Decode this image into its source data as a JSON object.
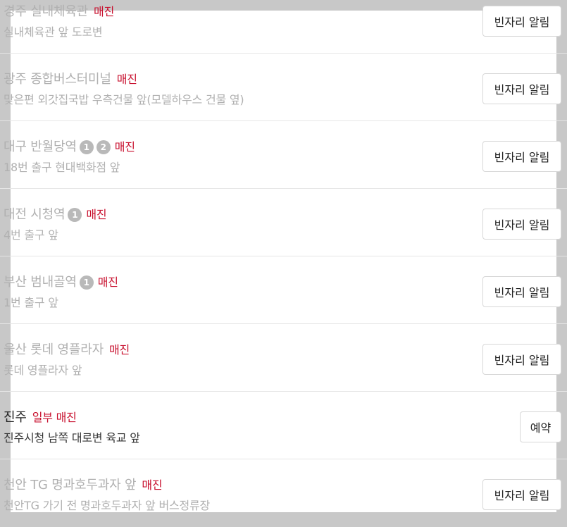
{
  "rows": [
    {
      "name": "경주 실내체육관",
      "badges": [],
      "status": "매진",
      "sub": "실내체육관 앞 도로변",
      "button": "빈자리 알림",
      "active": false
    },
    {
      "name": "광주 종합버스터미널",
      "badges": [],
      "status": "매진",
      "sub": "맞은편 외갓집국밥 우측건물 앞(모델하우스 건물 옆)",
      "button": "빈자리 알림",
      "active": false
    },
    {
      "name": "대구 반월당역",
      "badges": [
        "1",
        "2"
      ],
      "status": "매진",
      "sub": "18번 출구 현대백화점 앞",
      "button": "빈자리 알림",
      "active": false
    },
    {
      "name": "대전 시청역",
      "badges": [
        "1"
      ],
      "status": "매진",
      "sub": "4번 출구 앞",
      "button": "빈자리 알림",
      "active": false
    },
    {
      "name": "부산 범내골역",
      "badges": [
        "1"
      ],
      "status": "매진",
      "sub": "1번 출구 앞",
      "button": "빈자리 알림",
      "active": false
    },
    {
      "name": "울산 롯데 영플라자",
      "badges": [],
      "status": "매진",
      "sub": "롯데 영플라자 앞",
      "button": "빈자리 알림",
      "active": false
    },
    {
      "name": "진주",
      "badges": [],
      "status": "일부 매진",
      "sub": "진주시청 남쪽 대로변 육교 앞",
      "button": "예약",
      "active": true
    },
    {
      "name": "천안 TG 명과호두과자 앞",
      "badges": [],
      "status": "매진",
      "sub": "천안TG 가기 전 명과호두과자 앞 버스정류장",
      "button": "빈자리 알림",
      "active": false
    }
  ],
  "colors": {
    "overlay": "#c8c8c8",
    "sold_out": "#c8102e",
    "badge": "#b9b9b9",
    "muted_text": "#b0b0b0"
  }
}
